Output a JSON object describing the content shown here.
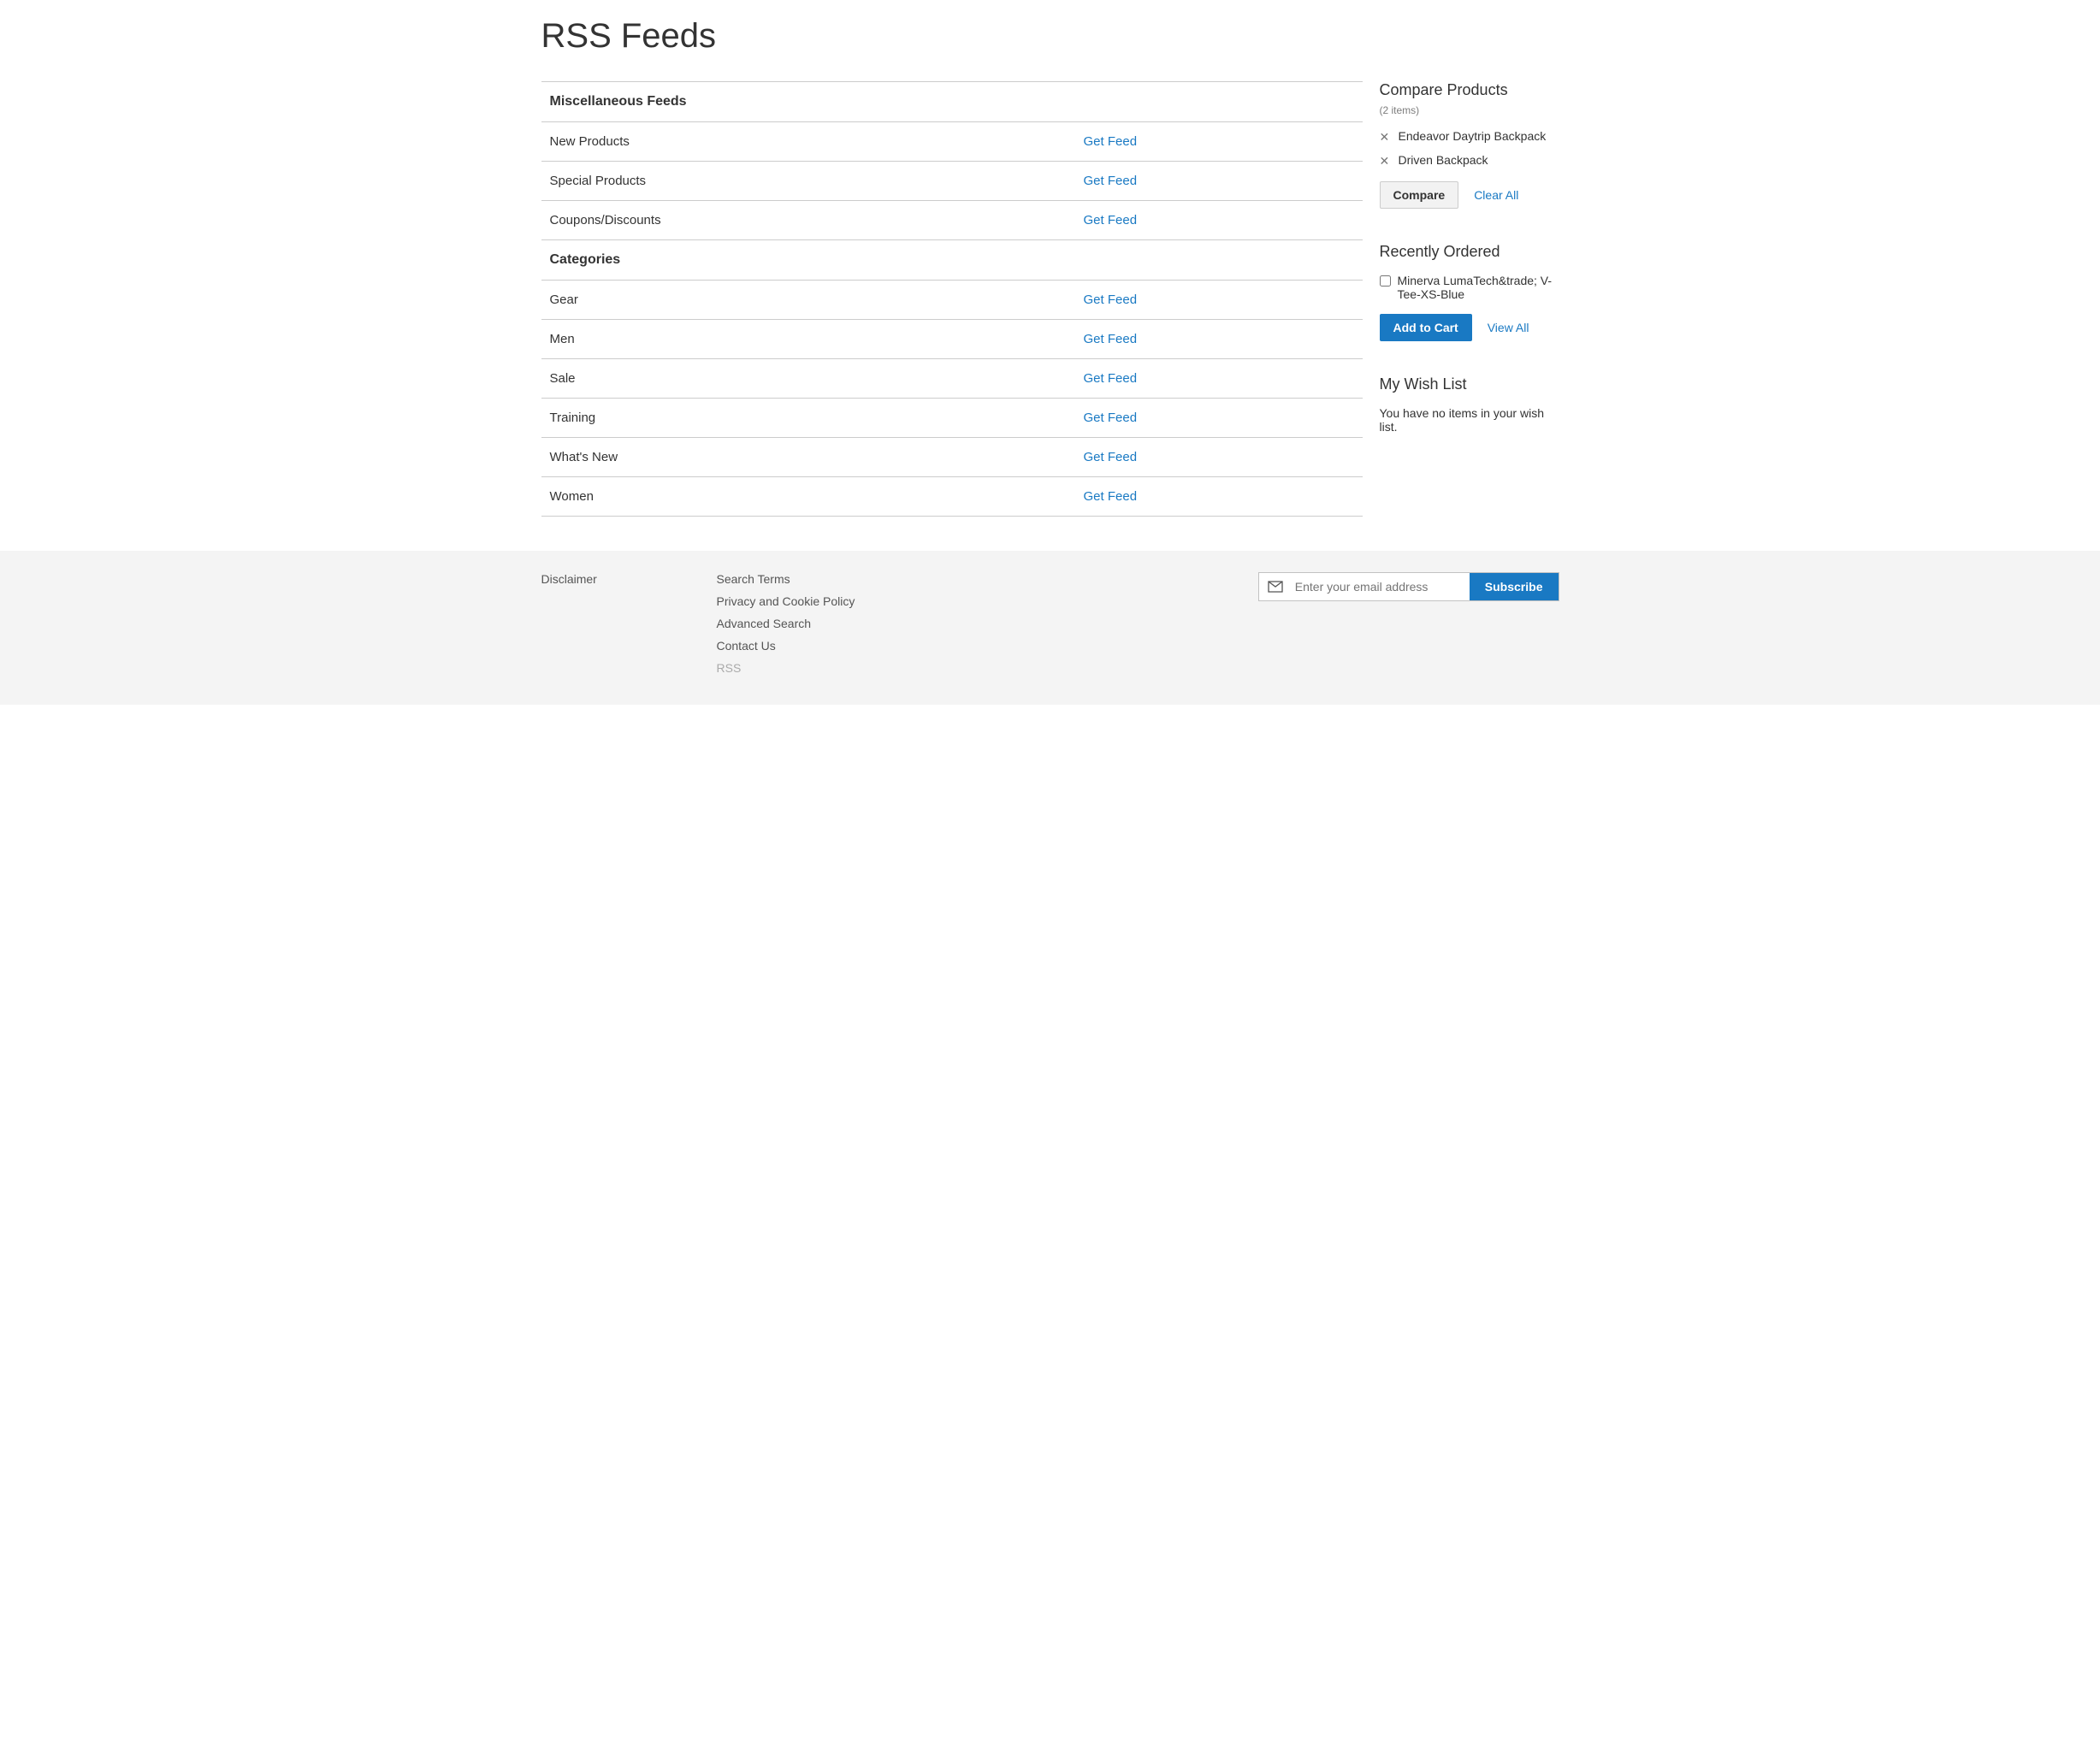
{
  "page": {
    "title": "RSS Feeds"
  },
  "feeds": {
    "sections": [
      {
        "header": "Miscellaneous Feeds",
        "items": [
          {
            "label": "New Products",
            "action": "Get Feed"
          },
          {
            "label": "Special Products",
            "action": "Get Feed"
          },
          {
            "label": "Coupons/Discounts",
            "action": "Get Feed"
          }
        ]
      },
      {
        "header": "Categories",
        "items": [
          {
            "label": "Gear",
            "action": "Get Feed"
          },
          {
            "label": "Men",
            "action": "Get Feed"
          },
          {
            "label": "Sale",
            "action": "Get Feed"
          },
          {
            "label": "Training",
            "action": "Get Feed"
          },
          {
            "label": "What's New",
            "action": "Get Feed"
          },
          {
            "label": "Women",
            "action": "Get Feed"
          }
        ]
      }
    ]
  },
  "compare": {
    "title": "Compare Products",
    "count_text": "(2 items)",
    "items": [
      {
        "name": "Endeavor Daytrip Backpack"
      },
      {
        "name": "Driven Backpack"
      }
    ],
    "compare_button": "Compare",
    "clear_all": "Clear All"
  },
  "reorder": {
    "title": "Recently Ordered",
    "items": [
      {
        "name": "Minerva LumaTech&trade; V-Tee-XS-Blue"
      }
    ],
    "add_button": "Add to Cart",
    "view_all": "View All"
  },
  "wishlist": {
    "title": "My Wish List",
    "empty": "You have no items in your wish list."
  },
  "footer": {
    "disclaimer": "Disclaimer",
    "links": [
      {
        "label": "Search Terms",
        "current": false
      },
      {
        "label": "Privacy and Cookie Policy",
        "current": false
      },
      {
        "label": "Advanced Search",
        "current": false
      },
      {
        "label": "Contact Us",
        "current": false
      },
      {
        "label": "RSS",
        "current": true
      }
    ],
    "newsletter": {
      "placeholder": "Enter your email address",
      "button": "Subscribe"
    }
  }
}
